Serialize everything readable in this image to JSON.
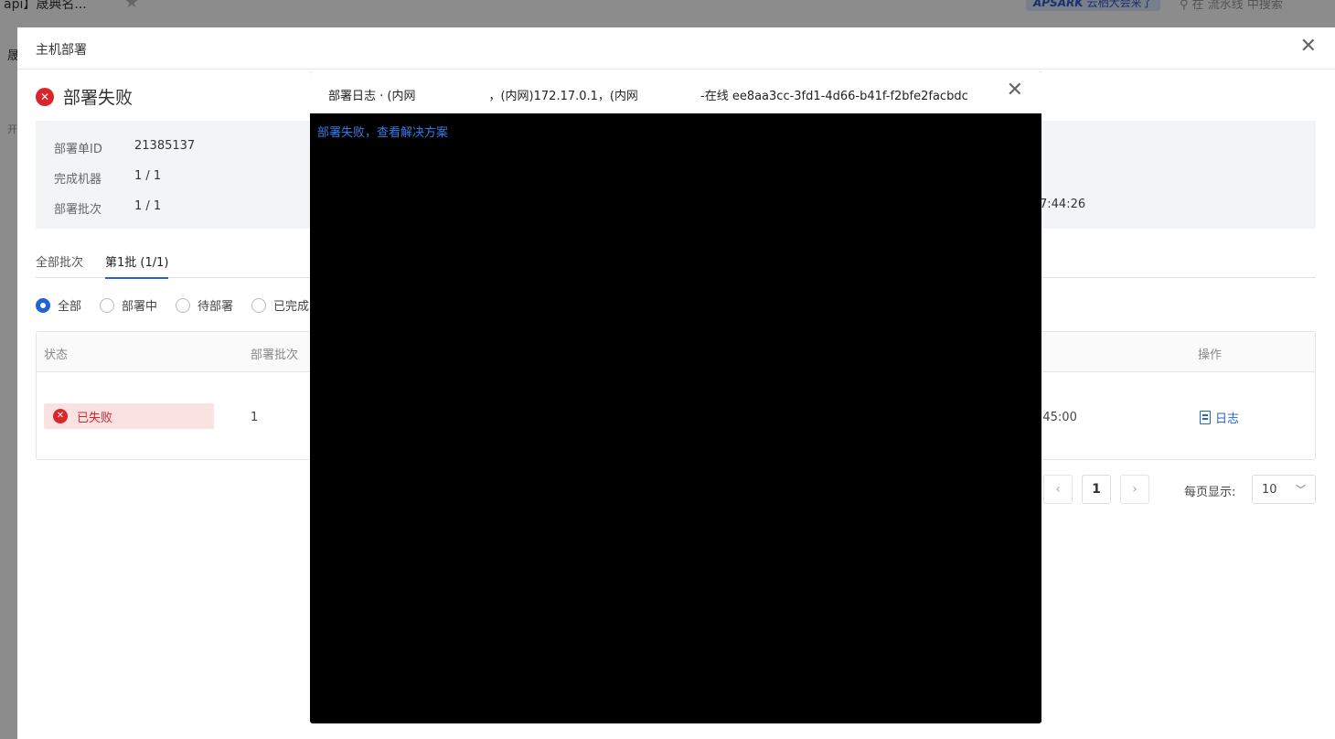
{
  "app": {
    "breadcrumb": "api】晟典名...",
    "banner_brand": "APSARK",
    "banner_text": "云栖大会来了",
    "search_placeholder": "在 流水线 中搜索",
    "left_char_1": "晟",
    "left_char_2": "开"
  },
  "drawer": {
    "title": "主机部署",
    "status": "部署失败",
    "info": [
      {
        "label": "部署单ID",
        "value": "21385137"
      },
      {
        "label": "完成机器",
        "value": "1 / 1"
      },
      {
        "label": "部署批次",
        "value": "1 / 1"
      }
    ],
    "info_time": "7:44:26",
    "tabs": [
      {
        "label": "全部批次",
        "active": false
      },
      {
        "label": "第1批 (1/1)",
        "active": true
      }
    ],
    "filters": [
      {
        "label": "全部",
        "checked": true
      },
      {
        "label": "部署中",
        "checked": false
      },
      {
        "label": "待部署",
        "checked": false
      },
      {
        "label": "已完成",
        "checked": false
      }
    ],
    "table": {
      "headers": {
        "status": "状态",
        "batch": "部署批次",
        "action": "操作"
      },
      "row": {
        "status": "已失败",
        "batch": "1",
        "time": ":45:00",
        "action": "日志"
      }
    },
    "pager": {
      "current": "1",
      "page_size_label": "每页显示:",
      "page_size": "10"
    }
  },
  "modal": {
    "title_prefix": "部署日志 · (内网",
    "title_mid": "，(内网)172.17.0.1，(内网",
    "title_suffix": "-在线 ee8aa3cc-3fd1-4d66-b41f-f2bfe2facbdc",
    "body_link": "部署失败，查看解决方案"
  },
  "colors": {
    "accent": "#1f63d6",
    "error": "#d9262a",
    "error_bg": "#fbe2e2",
    "log_link": "#2f7ce8"
  }
}
